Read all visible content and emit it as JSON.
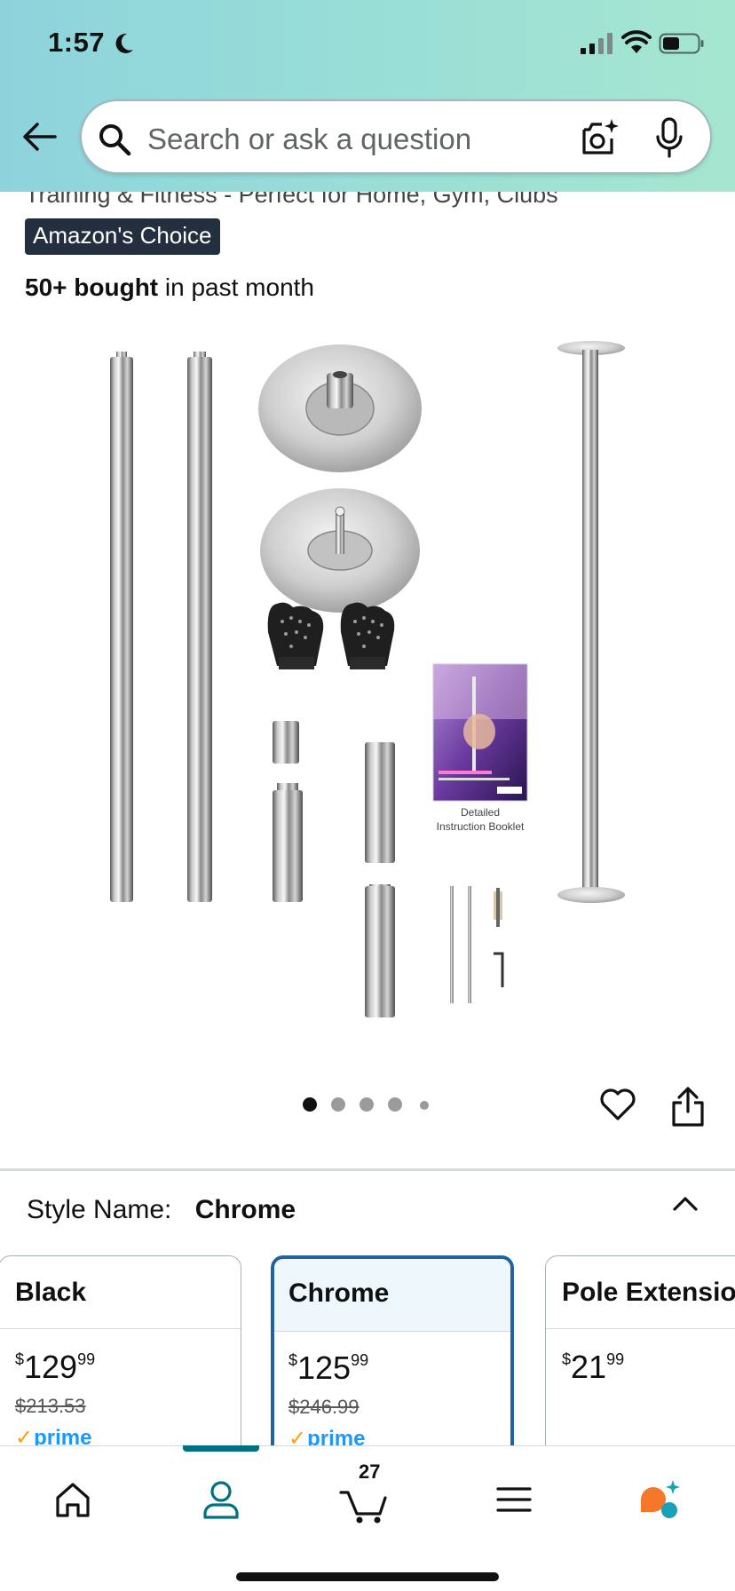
{
  "status_bar": {
    "time": "1:57",
    "icons": [
      "moon-icon",
      "signal-icon",
      "wifi-icon",
      "battery-icon"
    ]
  },
  "search": {
    "placeholder": "Search or ask a question",
    "icons": [
      "back-arrow-icon",
      "search-icon",
      "camera-icon",
      "mic-icon"
    ]
  },
  "product": {
    "title_partial": "Training & Fitness - Perfect for Home, Gym, Clubs",
    "badge": "Amazon's Choice",
    "bought_bold": "50+ bought",
    "bought_rest": " in past month",
    "image_caption_line1": "Detailed",
    "image_caption_line2": "Instruction Booklet"
  },
  "gallery": {
    "image_count": 5,
    "active_index": 0
  },
  "style": {
    "label": "Style Name:",
    "value": "Chrome"
  },
  "variants": [
    {
      "name": "Black",
      "currency": "$",
      "whole": "129",
      "cents": "99",
      "list_price": "$213.53",
      "prime": "prime",
      "selected": false
    },
    {
      "name": "Chrome",
      "currency": "$",
      "whole": "125",
      "cents": "99",
      "list_price": "$246.99",
      "prime": "prime",
      "selected": true
    },
    {
      "name": "Pole Extension",
      "currency": "$",
      "whole": "21",
      "cents": "99",
      "list_price": "",
      "prime": "",
      "selected": false
    }
  ],
  "bottom_nav": {
    "items": [
      "home-icon",
      "account-icon",
      "cart-icon",
      "menu-icon",
      "rufus-icon"
    ],
    "active": "account-icon",
    "cart_count": "27"
  },
  "colors": {
    "header_gradient_start": "#8ed3dc",
    "header_gradient_end": "#a6e6d0",
    "badge_bg": "#232f3e",
    "selected_border": "#2162a1",
    "prime_blue": "#1a98ff",
    "nav_active": "#007185",
    "rufus_orange": "#f5782a",
    "rufus_teal": "#1aa0b8"
  }
}
